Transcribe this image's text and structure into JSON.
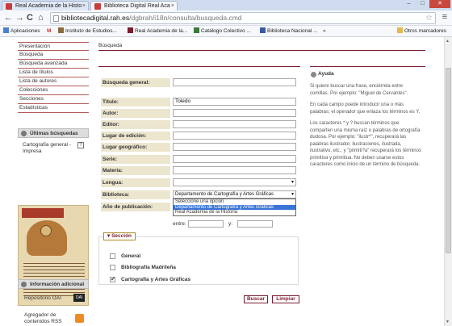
{
  "browser": {
    "tabs": [
      {
        "title": "Real Academia de la Histo"
      },
      {
        "title": "Biblioteca Digital Real Aca"
      }
    ],
    "close_glyph": "×",
    "window_controls": {
      "minimize": "–",
      "maximize": "□",
      "close": "✕"
    },
    "url_domain": "bibliotecadigital.rah.es",
    "url_path": "/dgbrah/i18n/consulta/busqueda.cmd",
    "nav": {
      "back": "←",
      "forward": "→",
      "reload": "C",
      "home": "⌂",
      "star": "☆",
      "wrench": "🔧"
    },
    "bookmarks": [
      {
        "label": "Aplicaciones"
      },
      {
        "label": "M"
      },
      {
        "label": "Instituto de Estudios..."
      },
      {
        "label": "Real Academia de la..."
      },
      {
        "label": "Catálogo Colectivo ..."
      },
      {
        "label": "Biblioteca Nacional ..."
      }
    ],
    "bookmarks_more": "»",
    "other_bookmarks": "Otros marcadores",
    "scroll_up": "▲",
    "scroll_down": "▼"
  },
  "leftnav": {
    "items": [
      "Presentación",
      "Búsqueda",
      "Búsqueda avanzada",
      "Lista de títulos",
      "Lista de autores",
      "Colecciones",
      "Secciones",
      "Estadísticas"
    ]
  },
  "recent": {
    "title": "Últimas búsquedas",
    "item": "Cartografía general - Impresa",
    "badge": "?"
  },
  "info": {
    "title": "Información adicional",
    "items": [
      "Repositorio OAI",
      "Agregador de contenidos RSS"
    ],
    "oai_icon": "OAI"
  },
  "content": {
    "title": "Búsqueda"
  },
  "form": {
    "fields": [
      {
        "label": "Búsqueda general:",
        "value": ""
      },
      {
        "label": "Título:",
        "value": "Toledo"
      },
      {
        "label": "Autor:",
        "value": ""
      },
      {
        "label": "Editor:",
        "value": ""
      },
      {
        "label": "Lugar de edición:",
        "value": ""
      },
      {
        "label": "Lugar geográfico:",
        "value": ""
      },
      {
        "label": "Serie:",
        "value": ""
      },
      {
        "label": "Materia:",
        "value": ""
      },
      {
        "label": "Lengua:",
        "value": ""
      },
      {
        "label": "Biblioteca:",
        "value": "Departamento de Cartografía y Artes Gráficas"
      },
      {
        "label": "Año de publicación:",
        "value": ""
      }
    ],
    "select_arrow": "▾",
    "dropdown_options": [
      "Seleccione una opción",
      "Departamento de Cartografía y Artes Gráficas",
      "Real Academia de la Historia"
    ],
    "range_from": "entre:",
    "range_to": "y:"
  },
  "section": {
    "legend": "Sección",
    "collapse_glyph": "▾",
    "check_glyph": "✔",
    "items": [
      {
        "label": "General",
        "checked": false
      },
      {
        "label": "Bibliografía Madrileña",
        "checked": false
      },
      {
        "label": "Cartografía y Artes Gráficas",
        "checked": true
      }
    ]
  },
  "buttons": {
    "search": "Buscar",
    "clear": "Limpiar"
  },
  "help": {
    "title": "Ayuda",
    "paragraphs": [
      "Si quiere buscar una frase, enciérrela entre comillas. Por ejemplo: \"Miguel de Cervantes\".",
      "En cada campo puede introducir una o más palabras; el operador que enlaza los términos es Y.",
      "Los caracteres * y ? buscan términos que comparten una misma raíz o palabras de ortografía dudosa. Por ejemplo: \"ilustr*\", recuperará las palabras ilustrador, ilustraciones, ilustrada, ilustrativo, etc.; y \"primiti?a\" recuperará los términos primitiva y primitiua. No deben usarse estos caracteres como inicio de un término de búsqueda."
    ]
  },
  "colors": {
    "accent": "#7a1c2e",
    "label_bg": "#ece6cf",
    "highlight": "#3875d7"
  }
}
